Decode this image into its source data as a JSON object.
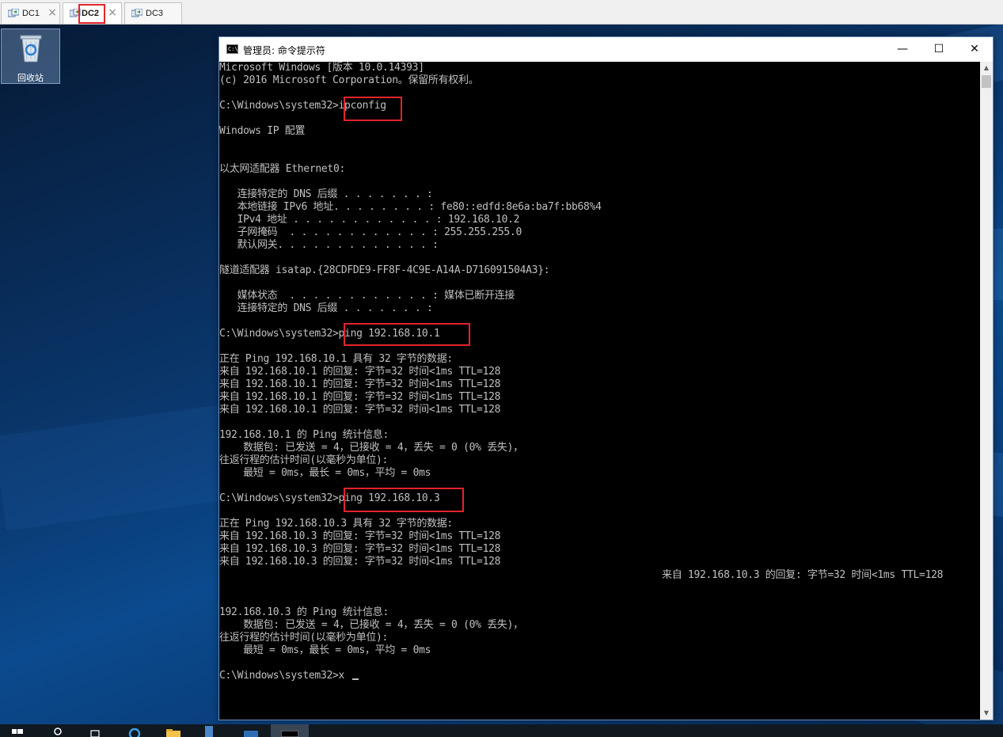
{
  "vm_tabs": [
    {
      "label": "DC1"
    },
    {
      "label": "DC2"
    },
    {
      "label": "DC3"
    }
  ],
  "desktop": {
    "recycle_bin_label": "回收站"
  },
  "window": {
    "title": "管理员: 命令提示符",
    "title_icon_text": "C:\\",
    "minimize_glyph": "—",
    "maximize_glyph": "☐",
    "close_glyph": "✕"
  },
  "console": {
    "lines": [
      "Microsoft Windows [版本 10.0.14393]",
      "(c) 2016 Microsoft Corporation。保留所有权利。",
      "",
      "C:\\Windows\\system32>ipconfig",
      "",
      "Windows IP 配置",
      "",
      "",
      "以太网适配器 Ethernet0:",
      "",
      "   连接特定的 DNS 后缀 . . . . . . . :",
      "   本地链接 IPv6 地址. . . . . . . . : fe80::edfd:8e6a:ba7f:bb68%4",
      "   IPv4 地址 . . . . . . . . . . . . : 192.168.10.2",
      "   子网掩码  . . . . . . . . . . . . : 255.255.255.0",
      "   默认网关. . . . . . . . . . . . . :",
      "",
      "隧道适配器 isatap.{28CDFDE9-FF8F-4C9E-A14A-D716091504A3}:",
      "",
      "   媒体状态  . . . . . . . . . . . . : 媒体已断开连接",
      "   连接特定的 DNS 后缀 . . . . . . . :",
      "",
      "C:\\Windows\\system32>ping 192.168.10.1",
      "",
      "正在 Ping 192.168.10.1 具有 32 字节的数据:",
      "来自 192.168.10.1 的回复: 字节=32 时间<1ms TTL=128",
      "来自 192.168.10.1 的回复: 字节=32 时间<1ms TTL=128",
      "来自 192.168.10.1 的回复: 字节=32 时间<1ms TTL=128",
      "来自 192.168.10.1 的回复: 字节=32 时间<1ms TTL=128",
      "",
      "192.168.10.1 的 Ping 统计信息:",
      "    数据包: 已发送 = 4，已接收 = 4，丢失 = 0 (0% 丢失)，",
      "往返行程的估计时间(以毫秒为单位):",
      "    最短 = 0ms，最长 = 0ms，平均 = 0ms",
      "",
      "C:\\Windows\\system32>ping 192.168.10.3",
      "",
      "正在 Ping 192.168.10.3 具有 32 字节的数据:",
      "来自 192.168.10.3 的回复: 字节=32 时间<1ms TTL=128",
      "来自 192.168.10.3 的回复: 字节=32 时间<1ms TTL=128",
      "来自 192.168.10.3 的回复: 字节=32 时间<1ms TTL=128",
      "",
      "",
      "",
      "192.168.10.3 的 Ping 统计信息:",
      "    数据包: 已发送 = 4，已接收 = 4，丢失 = 0 (0% 丢失)，",
      "往返行程的估计时间(以毫秒为单位):",
      "    最短 = 0ms，最长 = 0ms，平均 = 0ms",
      "",
      "C:\\Windows\\system32>x"
    ],
    "stray_line": "来自 192.168.10.3 的回复: 字节=32 时间<1ms TTL=128"
  },
  "scrollbar": {
    "up_glyph": "▲",
    "down_glyph": "▼"
  },
  "colors": {
    "console_bg": "#000000",
    "console_fg": "#c0c0c0",
    "highlight": "#e3242b"
  }
}
